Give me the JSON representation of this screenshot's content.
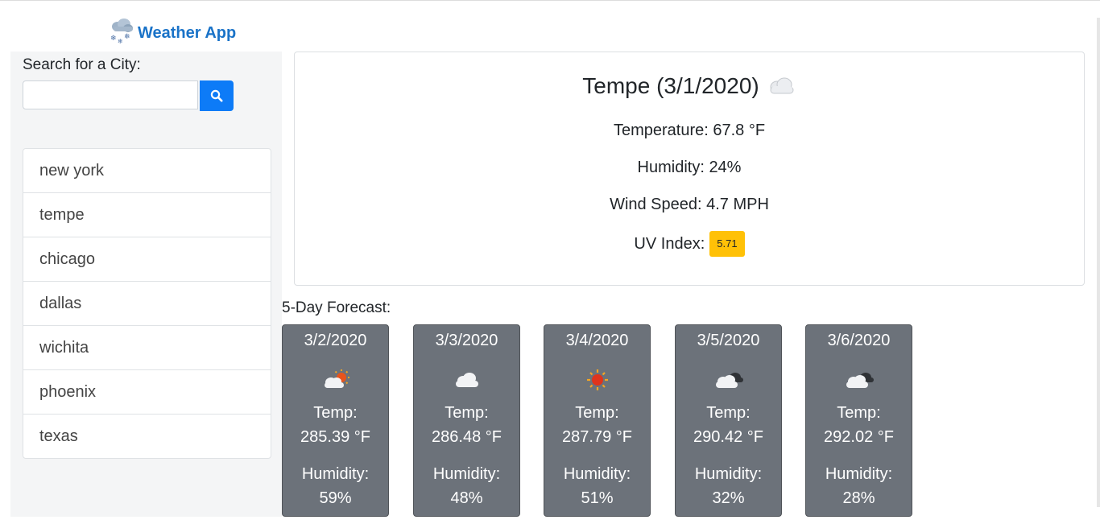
{
  "brand": {
    "title": "Weather App",
    "icon": "snow-cloud-icon"
  },
  "search": {
    "label": "Search for a City:",
    "value": "",
    "placeholder": "",
    "button_icon": "search-icon"
  },
  "history": [
    "new york",
    "tempe",
    "chicago",
    "dallas",
    "wichita",
    "phoenix",
    "texas"
  ],
  "current": {
    "title": "Tempe (3/1/2020)",
    "icon": "cloud-icon",
    "temperature": "Temperature: 67.8 °F",
    "humidity": "Humidity: 24%",
    "wind": "Wind Speed: 4.7 MPH",
    "uv_label": "UV Index:",
    "uv_value": "5.71"
  },
  "forecast": {
    "title": "5-Day Forecast:",
    "temp_label": "Temp:",
    "humidity_label": "Humidity:",
    "days": [
      {
        "date": "3/2/2020",
        "icon": "partly-sunny-icon",
        "temp": "285.39 °F",
        "humidity": "59%"
      },
      {
        "date": "3/3/2020",
        "icon": "cloud-icon",
        "temp": "286.48 °F",
        "humidity": "48%"
      },
      {
        "date": "3/4/2020",
        "icon": "sun-icon",
        "temp": "287.79 °F",
        "humidity": "51%"
      },
      {
        "date": "3/5/2020",
        "icon": "broken-clouds-icon",
        "temp": "290.42 °F",
        "humidity": "32%"
      },
      {
        "date": "3/6/2020",
        "icon": "broken-clouds-icon",
        "temp": "292.02 °F",
        "humidity": "28%"
      }
    ]
  },
  "colors": {
    "accent": "#0d7bf7",
    "brand": "#1a73c8",
    "card_bg": "#6c727a",
    "uv_badge": "#ffc107",
    "sidebar_bg": "#f4f5f6"
  }
}
